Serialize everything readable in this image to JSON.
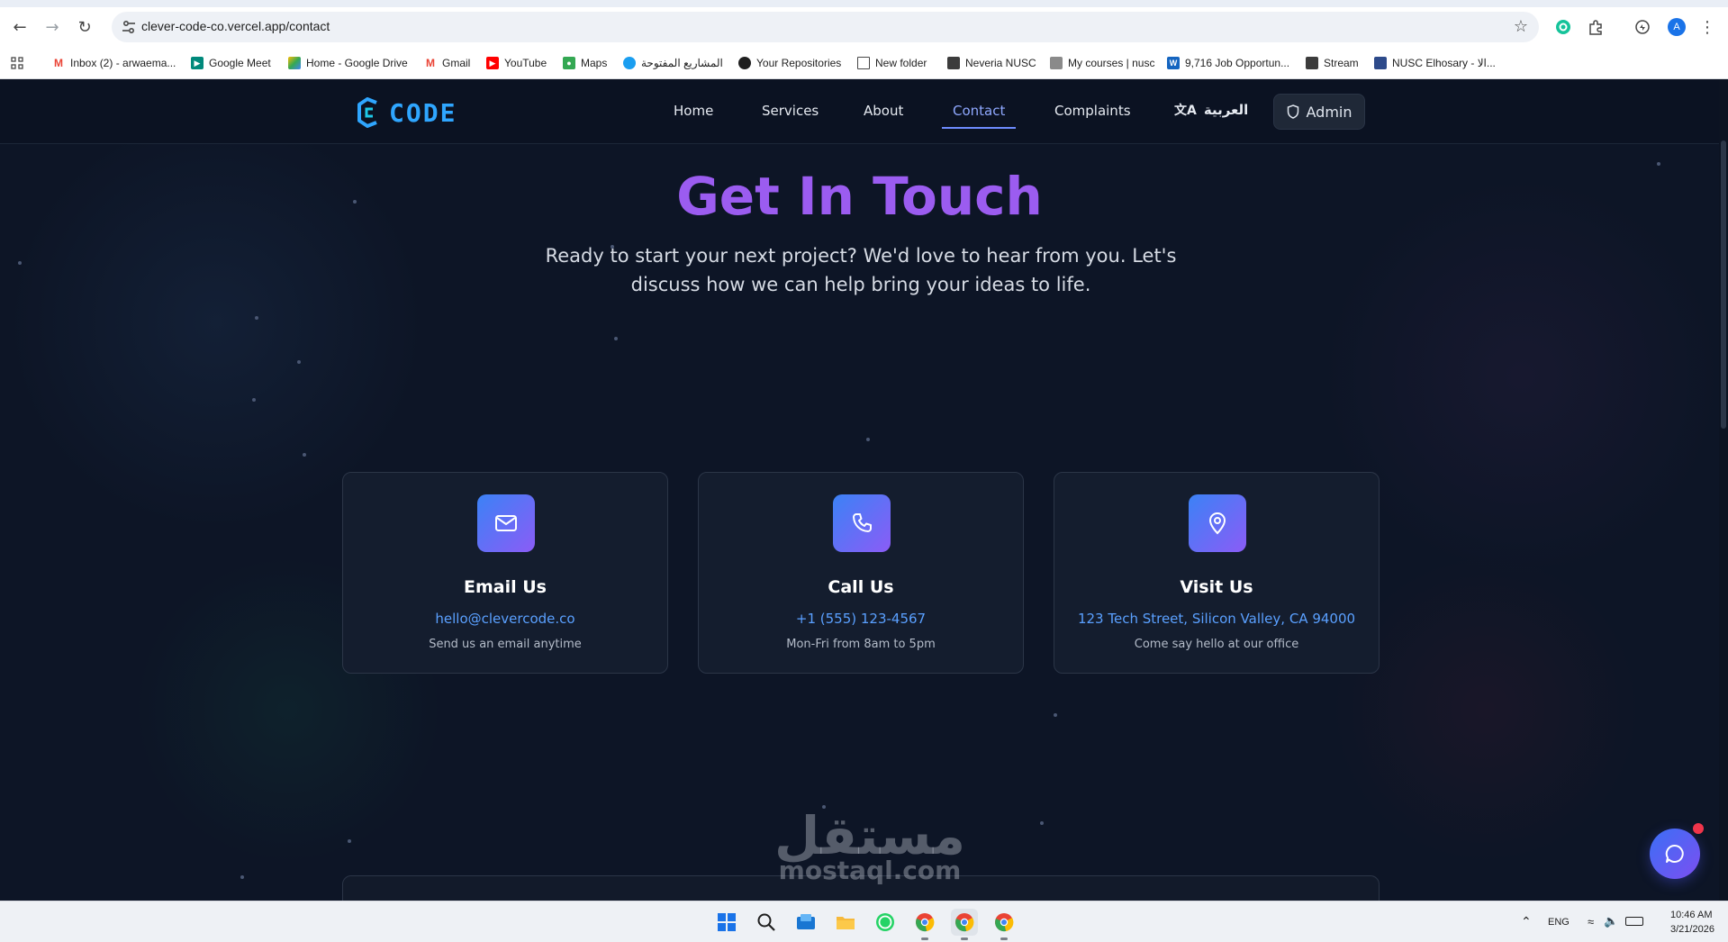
{
  "browser": {
    "url": "clever-code-co.vercel.app/contact",
    "profile_initial": "A",
    "bookmarks": [
      {
        "label": "Inbox (2) - arwaema...",
        "icon": "gmail-icon"
      },
      {
        "label": "Google Meet",
        "icon": "google-meet-icon"
      },
      {
        "label": "Home - Google Drive",
        "icon": "google-drive-icon"
      },
      {
        "label": "Gmail",
        "icon": "gmail-icon"
      },
      {
        "label": "YouTube",
        "icon": "youtube-icon"
      },
      {
        "label": "Maps",
        "icon": "maps-icon"
      },
      {
        "label": "المشاريع المفتوحة",
        "icon": "globe-icon"
      },
      {
        "label": "Your Repositories",
        "icon": "github-icon"
      },
      {
        "label": "New folder",
        "icon": "folder-icon"
      },
      {
        "label": "Neveria NUSC",
        "icon": "site-icon"
      },
      {
        "label": "My courses | nusc",
        "icon": "site-icon"
      },
      {
        "label": "9,716 Job Opportun...",
        "icon": "wuzzuf-icon"
      },
      {
        "label": "Stream",
        "icon": "site-icon"
      },
      {
        "label": "NUSC Elhosary - الا...",
        "icon": "site-icon"
      }
    ]
  },
  "site": {
    "logo_text": "CODE",
    "nav": {
      "home": "Home",
      "services": "Services",
      "about": "About",
      "contact": "Contact",
      "complaints": "Complaints",
      "language": "العربية",
      "admin": "Admin"
    },
    "active_nav": "Contact",
    "accent_color": "#9b5cf0",
    "link_color": "#5aa0ff"
  },
  "hero": {
    "title": "Get In Touch",
    "subtitle": "Ready to start your next project? We'd love to hear from you. Let's discuss how we can help bring your ideas to life."
  },
  "contact_cards": [
    {
      "icon": "mail-icon",
      "title": "Email Us",
      "value": "hello@clevercode.co",
      "description": "Send us an email anytime"
    },
    {
      "icon": "phone-icon",
      "title": "Call Us",
      "value": "+1 (555) 123-4567",
      "description": "Mon-Fri from 8am to 5pm"
    },
    {
      "icon": "map-pin-icon",
      "title": "Visit Us",
      "value": "123 Tech Street, Silicon Valley, CA 94000",
      "description": "Come say hello at our office"
    }
  ],
  "watermark": {
    "arabic": "مستقل",
    "latin": "mostaql.com"
  },
  "taskbar": {
    "language": "ENG",
    "time": "10:46 AM",
    "date": "3/21/2026"
  }
}
